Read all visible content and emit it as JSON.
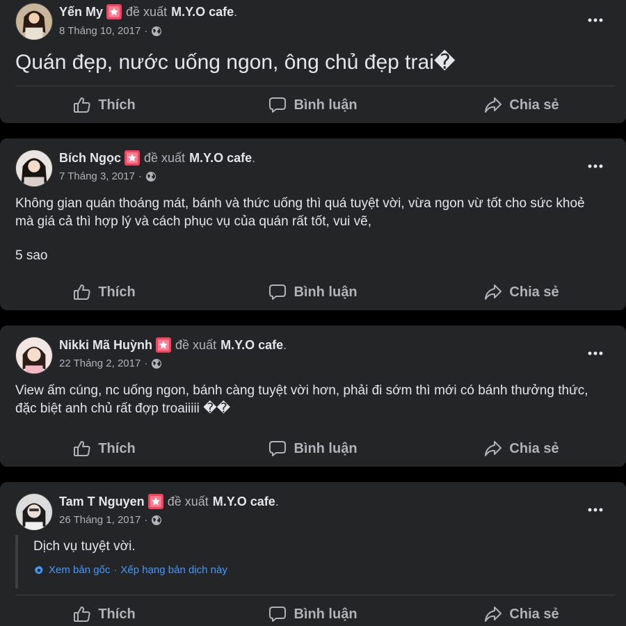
{
  "colors": {
    "background": "#000000",
    "card": "#242526",
    "text_primary": "#e4e6eb",
    "text_secondary": "#b0b3b8",
    "link_blue": "#4599ff",
    "badge_red": "#f02849"
  },
  "actions": {
    "like_label": "Thích",
    "comment_label": "Bình luận",
    "share_label": "Chia sẻ",
    "like_icon": "thumbs-up-icon",
    "comment_icon": "speech-bubble-icon",
    "share_icon": "share-arrow-icon"
  },
  "posts": [
    {
      "author": "Yến My",
      "verb": "đề xuất",
      "page": "M.Y.O cafe",
      "date": "8 Tháng 10, 2017",
      "text": "Quán đẹp, nước uống ngon, ông chủ đẹp trai�"
    },
    {
      "author": "Bích Ngọc",
      "verb": "đề xuất",
      "page": "M.Y.O cafe",
      "date": "7 Tháng 3, 2017",
      "text": "Không gian quán thoáng mát, bánh và thức uống thì quá tuyệt vời, vừa ngon vừ tốt cho sức khoẻ mà giá cả thì hợp lý và cách phục vụ của quán rất tốt, vui vẽ,",
      "rating_text": "5 sao"
    },
    {
      "author": "Nikki Mã Huỳnh",
      "verb": "đề xuất",
      "page": "M.Y.O cafe",
      "date": "22 Tháng 2, 2017",
      "text": "View ấm cúng, nc uống ngon, bánh càng tuyệt vời hơn, phải đi sớm thì mới có bánh thưởng thức, đặc biệt anh chủ rất đợp troaiiiii ��"
    },
    {
      "author": "Tam T Nguyen",
      "verb": "đề xuất",
      "page": "M.Y.O cafe",
      "date": "26 Tháng 1, 2017",
      "text": "Dịch vụ tuyệt vời.",
      "see_original": "Xem bản gốc",
      "rate_translation": "Xếp hạng bản dịch này"
    }
  ],
  "separators": {
    "meta_dot": "·",
    "name_dot": "."
  }
}
